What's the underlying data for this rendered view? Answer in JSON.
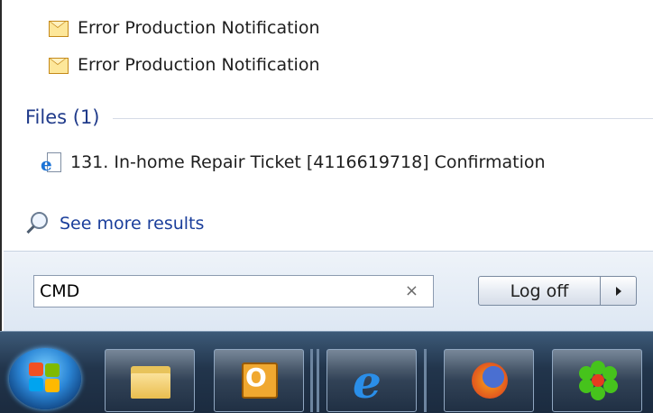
{
  "results": {
    "messages": [
      {
        "icon": "envelope-icon",
        "label": "Error Production Notification"
      },
      {
        "icon": "envelope-icon",
        "label": "Error Production Notification"
      }
    ],
    "files_header": "Files (1)",
    "files": [
      {
        "icon": "internet-explorer-file-icon",
        "label": "131. In-home Repair Ticket [4116619718] Confirmation"
      }
    ],
    "see_more": "See more results"
  },
  "search": {
    "value": "CMD",
    "clear_glyph": "×"
  },
  "power": {
    "button_label": "Log off",
    "arrow_icon": "triangle-right-icon"
  },
  "taskbar": {
    "start_icon": "windows-start-orb",
    "apps": [
      {
        "name": "windows-explorer",
        "icon": "folder-icon"
      },
      {
        "name": "outlook",
        "icon": "outlook-icon"
      },
      {
        "name": "internet-explorer",
        "icon": "internet-explorer-icon"
      },
      {
        "name": "firefox",
        "icon": "firefox-icon"
      },
      {
        "name": "icq",
        "icon": "icq-flower-icon"
      }
    ]
  },
  "colors": {
    "link_blue": "#1a3e9b",
    "header_blue": "#1f3a8a",
    "taskbar_dark": "#22354c"
  }
}
